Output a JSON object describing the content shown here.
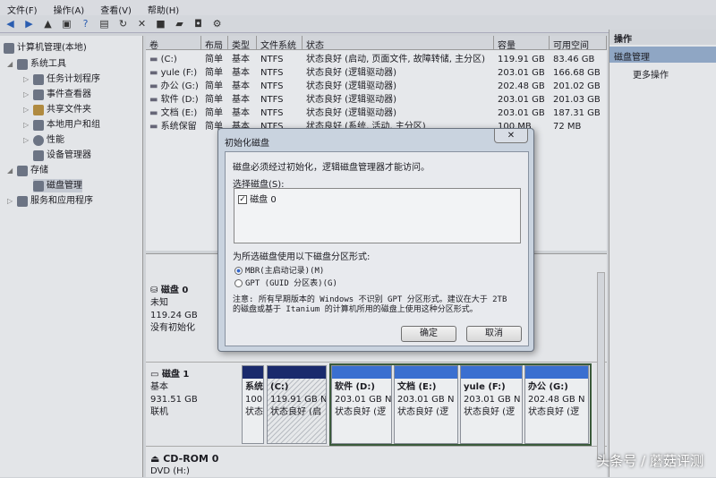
{
  "menu": [
    "文件(F)",
    "操作(A)",
    "查看(V)",
    "帮助(H)"
  ],
  "toolbar_icons": [
    "back-icon",
    "forward-icon",
    "up-icon",
    "show-hide-tree-icon",
    "help-icon",
    "properties-icon",
    "refresh-icon",
    "delete-icon",
    "new-icon",
    "open-icon",
    "rescan-icon",
    "settings-icon"
  ],
  "tree": {
    "root": "计算机管理(本地)",
    "system_tools": "系统工具",
    "task_scheduler": "任务计划程序",
    "event_viewer": "事件查看器",
    "shared_folders": "共享文件夹",
    "local_users": "本地用户和组",
    "performance": "性能",
    "device_manager": "设备管理器",
    "storage": "存储",
    "disk_management": "磁盘管理",
    "services": "服务和应用程序"
  },
  "table": {
    "headers": [
      "卷",
      "布局",
      "类型",
      "文件系统",
      "状态",
      "容量",
      "可用空间"
    ],
    "rows": [
      [
        "(C:)",
        "简单",
        "基本",
        "NTFS",
        "状态良好 (启动, 页面文件, 故障转储, 主分区)",
        "119.91 GB",
        "83.46 GB"
      ],
      [
        "yule (F:)",
        "简单",
        "基本",
        "NTFS",
        "状态良好 (逻辑驱动器)",
        "203.01 GB",
        "166.68 GB"
      ],
      [
        "办公 (G:)",
        "简单",
        "基本",
        "NTFS",
        "状态良好 (逻辑驱动器)",
        "202.48 GB",
        "201.02 GB"
      ],
      [
        "软件 (D:)",
        "简单",
        "基本",
        "NTFS",
        "状态良好 (逻辑驱动器)",
        "203.01 GB",
        "201.03 GB"
      ],
      [
        "文档 (E:)",
        "简单",
        "基本",
        "NTFS",
        "状态良好 (逻辑驱动器)",
        "203.01 GB",
        "187.31 GB"
      ],
      [
        "系统保留",
        "简单",
        "基本",
        "NTFS",
        "状态良好 (系统, 活动, 主分区)",
        "100 MB",
        "72 MB"
      ]
    ]
  },
  "actions": {
    "title": "操作",
    "section": "磁盘管理",
    "more": "更多操作"
  },
  "disks": [
    {
      "name": "磁盘 0",
      "type": "未知",
      "size": "119.24 GB",
      "status": "没有初始化"
    },
    {
      "name": "磁盘 1",
      "type": "基本",
      "size": "931.51 GB",
      "status": "联机"
    },
    {
      "name": "CD-ROM 0",
      "type": "DVD (H:)"
    }
  ],
  "partitions": [
    {
      "name": "系统",
      "size": "100",
      "status": "状态"
    },
    {
      "name": "(C:)",
      "size": "119.91 GB N",
      "status": "状态良好 (启"
    },
    {
      "name": "软件  (D:)",
      "size": "203.01 GB N",
      "status": "状态良好 (逻"
    },
    {
      "name": "文档  (E:)",
      "size": "203.01 GB N",
      "status": "状态良好 (逻"
    },
    {
      "name": "yule  (F:)",
      "size": "203.01 GB N",
      "status": "状态良好 (逻"
    },
    {
      "name": "办公  (G:)",
      "size": "202.48 GB N",
      "status": "状态良好 (逻"
    }
  ],
  "dialog": {
    "title": "初始化磁盘",
    "message": "磁盘必须经过初始化，逻辑磁盘管理器才能访问。",
    "select_label": "选择磁盘(S):",
    "disk_item": "磁盘 0",
    "style_label": "为所选磁盘使用以下磁盘分区形式:",
    "mbr": "MBR(主启动记录)(M)",
    "gpt": "GPT (GUID 分区表)(G)",
    "note": "注意: 所有早期版本的 Windows 不识别 GPT 分区形式。建议在大于 2TB 的磁盘或基于 Itanium 的计算机所用的磁盘上使用这种分区形式。",
    "ok": "确定",
    "cancel": "取消",
    "close": "✕"
  },
  "watermark": "头条号 / 蘑菇评测",
  "colors": {
    "primary_bar": "#1a2a6c",
    "logical_bar": "#3a6fd0",
    "selection": "#2f5da8"
  }
}
